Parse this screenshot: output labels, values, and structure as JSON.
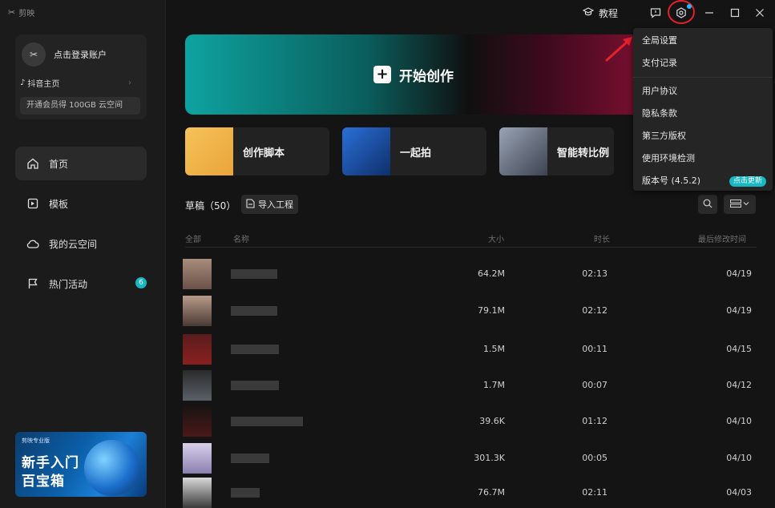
{
  "app": {
    "name": "剪映"
  },
  "sidebar": {
    "account": {
      "login": "点击登录账户",
      "douyin": "抖音主页",
      "vip": "开通会员得 100GB 云空间"
    },
    "nav": [
      {
        "label": "首页",
        "icon": "home-icon"
      },
      {
        "label": "模板",
        "icon": "template-icon"
      },
      {
        "label": "我的云空间",
        "icon": "cloud-icon"
      },
      {
        "label": "热门活动",
        "icon": "flag-icon",
        "badge": "6"
      }
    ],
    "promo": {
      "small": "剪映专业版",
      "line1": "新手入门",
      "line2": "百宝箱"
    }
  },
  "topbar": {
    "tutorial": "教程"
  },
  "hero": {
    "label": "开始创作"
  },
  "cards": [
    {
      "label": "创作脚本"
    },
    {
      "label": "一起拍"
    },
    {
      "label": "智能转比例"
    }
  ],
  "drafts": {
    "title": "草稿（50）",
    "import": "导入工程"
  },
  "table": {
    "headers": {
      "all": "全部",
      "name": "名称",
      "size": "大小",
      "duration": "时长",
      "modified": "最后修改时间"
    },
    "rows": [
      {
        "size": "64.2M",
        "duration": "02:13",
        "date": "04/19"
      },
      {
        "size": "79.1M",
        "duration": "02:12",
        "date": "04/19"
      },
      {
        "size": "1.5M",
        "duration": "00:11",
        "date": "04/15"
      },
      {
        "size": "1.7M",
        "duration": "00:07",
        "date": "04/12"
      },
      {
        "size": "39.6K",
        "duration": "01:12",
        "date": "04/10"
      },
      {
        "size": "301.3K",
        "duration": "00:05",
        "date": "04/10"
      },
      {
        "size": "76.7M",
        "duration": "02:11",
        "date": "04/03"
      }
    ]
  },
  "menu": {
    "items1": [
      "全局设置",
      "支付记录"
    ],
    "items2": [
      "用户协议",
      "隐私条款",
      "第三方版权",
      "使用环境检测"
    ],
    "version": "版本号 (4.5.2)",
    "update": "点击更新"
  },
  "colors": {
    "accent": "#17b7c4",
    "highlight": "#e5212a"
  }
}
